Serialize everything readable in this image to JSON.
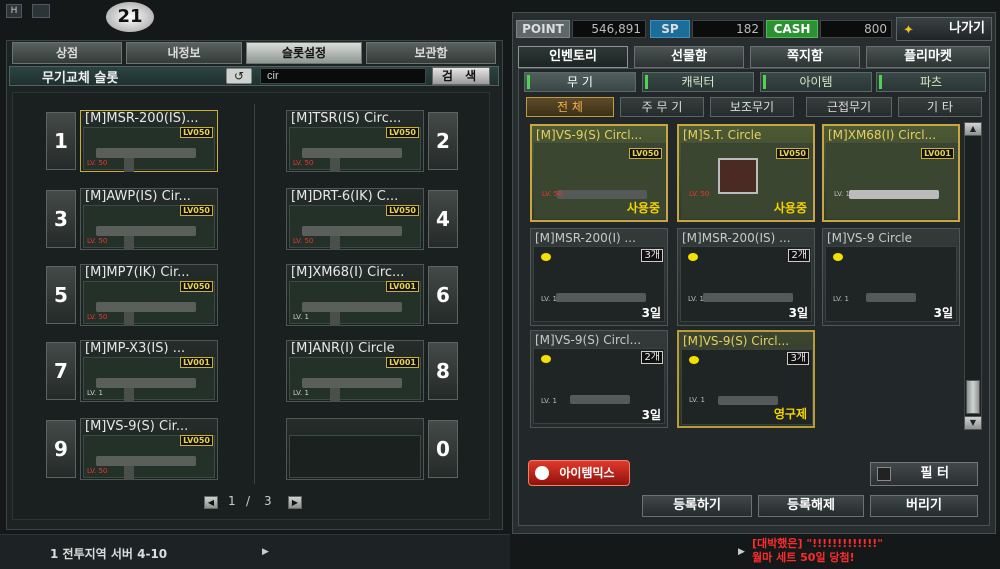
{
  "top": {
    "h_label": "H",
    "logo_text": "21"
  },
  "left_tabs": [
    "상점",
    "내정보",
    "슬롯설정",
    "보관함"
  ],
  "slot_header": {
    "title": "무기교체 슬롯",
    "undo_icon": "undo-icon",
    "search_value": "cir",
    "search_button": "검 색"
  },
  "slots": [
    {
      "num": "1",
      "name": "[M]MSR-200(IS)...",
      "badge": "LV050",
      "level": "LV. 50",
      "selected": true
    },
    {
      "num": "2",
      "name": "[M]TSR(IS) Circ...",
      "badge": "LV050",
      "level": "LV. 50",
      "selected": false
    },
    {
      "num": "3",
      "name": "[M]AWP(IS) Cir...",
      "badge": "LV050",
      "level": "LV. 50",
      "selected": false
    },
    {
      "num": "4",
      "name": "[M]DRT-6(IK) C...",
      "badge": "LV050",
      "level": "LV. 50",
      "selected": false
    },
    {
      "num": "5",
      "name": "[M]MP7(IK) Cir...",
      "badge": "LV050",
      "level": "LV. 50",
      "selected": false
    },
    {
      "num": "6",
      "name": "[M]XM68(I) Circ...",
      "badge": "LV001",
      "level": "LV. 1",
      "selected": false
    },
    {
      "num": "7",
      "name": "[M]MP-X3(IS) ...",
      "badge": "LV001",
      "level": "LV. 1",
      "selected": false
    },
    {
      "num": "8",
      "name": "[M]ANR(I) Circle",
      "badge": "LV001",
      "level": "LV. 1",
      "selected": false
    },
    {
      "num": "9",
      "name": "[M]VS-9(S) Cir...",
      "badge": "LV050",
      "level": "LV. 50",
      "selected": false
    },
    {
      "num": "0",
      "name": "",
      "badge": "",
      "level": "",
      "selected": false
    }
  ],
  "pager": {
    "current": "1",
    "sep": "/",
    "total": "3",
    "prev_icon": "prev-icon",
    "next_icon": "next-icon"
  },
  "status": {
    "server": "1 전투지역 서버 4-10",
    "arrow": "▶"
  },
  "currency": {
    "point_label": "POINT",
    "point_value": "546,891",
    "sp_label": "SP",
    "sp_value": "182",
    "cash_label": "CASH",
    "cash_value": "800"
  },
  "exit_button": "나가기",
  "right_tabs": [
    "인벤토리",
    "선물함",
    "쪽지함",
    "플리마켓"
  ],
  "categories": [
    "무 기",
    "캐릭터",
    "아이템",
    "파츠"
  ],
  "subtabs": [
    "전 체",
    "주 무 기",
    "보조무기",
    "근접무기",
    "기 타"
  ],
  "items": [
    {
      "name": "[M]VS-9(S) Circl...",
      "badge": "LV050",
      "level": "LV. 50",
      "status": "사용중",
      "count": "",
      "days": "",
      "style": "gold"
    },
    {
      "name": "[M]S.T. Circle",
      "badge": "LV050",
      "level": "LV. 50",
      "status": "사용중",
      "count": "",
      "days": "",
      "style": "gold"
    },
    {
      "name": "[M]XM68(I) Circl...",
      "badge": "LV001",
      "level": "LV. 1",
      "status": "",
      "count": "",
      "days": "",
      "style": "gold"
    },
    {
      "name": "[M]MSR-200(I) ...",
      "badge": "",
      "level": "LV. 1",
      "status": "",
      "count": "3개",
      "days": "3일",
      "style": "plain"
    },
    {
      "name": "[M]MSR-200(IS) ...",
      "badge": "",
      "level": "LV. 1",
      "status": "",
      "count": "2개",
      "days": "3일",
      "style": "plain"
    },
    {
      "name": "[M]VS-9 Circle",
      "badge": "",
      "level": "LV. 1",
      "status": "",
      "count": "",
      "days": "3일",
      "style": "plain"
    },
    {
      "name": "[M]VS-9(S) Circl...",
      "badge": "",
      "level": "LV. 1",
      "status": "",
      "count": "2개",
      "days": "3일",
      "style": "plain"
    },
    {
      "name": "[M]VS-9(S) Circl...",
      "badge": "",
      "level": "LV. 1",
      "status": "영구제",
      "count": "3개",
      "days": "",
      "style": "gold2"
    }
  ],
  "scroll": {
    "up_icon": "▲",
    "down_icon": "▼"
  },
  "bottom_buttons": {
    "item_mix": "아이템믹스",
    "filter": "필 터",
    "register": "등록하기",
    "unregister": "등록해제",
    "discard": "버리기"
  },
  "news": {
    "line1": "[대박했은] \"!!!!!!!!!!!!!\"",
    "line2": "월마 세트 50일 당첨!"
  },
  "colors": {
    "gold": "#c8a640",
    "yellow": "#f5d400",
    "red_news": "#ff2b2b",
    "green_cat": "#4ed44e"
  }
}
